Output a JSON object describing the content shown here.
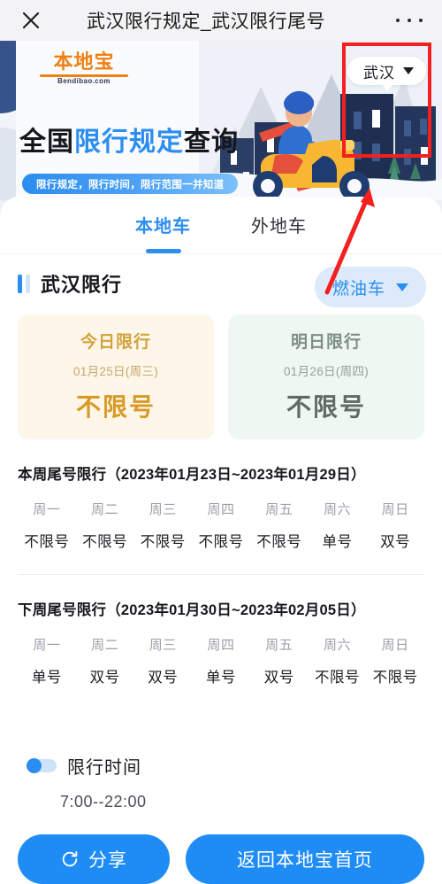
{
  "browser": {
    "title": "武汉限行规定_武汉限行尾号",
    "close_icon": "close-icon",
    "more_icon": "more-options-icon"
  },
  "banner": {
    "logo_main": "本地宝",
    "logo_sub": "Bendibao.com",
    "title_part1": "全国",
    "title_highlight": "限行规定",
    "title_part2": "查询",
    "subtitle_pill": "限行规定，限行时间，限行范围一并知道",
    "city_selector": {
      "label": "武汉",
      "caret_icon": "chevron-down-icon"
    }
  },
  "annotation": {
    "box_color": "#f41f1f",
    "arrow_color": "#f41f1f"
  },
  "tabs": [
    {
      "label": "本地车",
      "active": true
    },
    {
      "label": "外地车",
      "active": false
    }
  ],
  "section": {
    "title": "武汉限行",
    "fuel_selector": {
      "label": "燃油车",
      "caret_icon": "chevron-down-icon"
    }
  },
  "cards": [
    {
      "title": "今日限行",
      "date": "01月25日(周三)",
      "value": "不限号",
      "accent": "#d99a26",
      "bg": "#fdf6e9"
    },
    {
      "title": "明日限行",
      "date": "01月26日(周四)",
      "value": "不限号",
      "accent": "#5f6b63",
      "bg": "#eef7f1"
    }
  ],
  "weeks": [
    {
      "title": "本周尾号限行（2023年01月23日~2023年01月29日）",
      "days": [
        "周一",
        "周二",
        "周三",
        "周四",
        "周五",
        "周六",
        "周日"
      ],
      "values": [
        "不限号",
        "不限号",
        "不限号",
        "不限号",
        "不限号",
        "单号",
        "双号"
      ]
    },
    {
      "title": "下周尾号限行（2023年01月30日~2023年02月05日）",
      "days": [
        "周一",
        "周二",
        "周三",
        "周四",
        "周五",
        "周六",
        "周日"
      ],
      "values": [
        "单号",
        "双号",
        "双号",
        "单号",
        "双号",
        "不限号",
        "不限号"
      ]
    }
  ],
  "time_card": {
    "label": "限行时间",
    "value": "7:00--22:00",
    "toggle_on": true
  },
  "buttons": {
    "share": {
      "label": "分享",
      "icon": "share-refresh-icon"
    },
    "home": {
      "label": "返回本地宝首页"
    }
  },
  "colors": {
    "brand_blue": "#2b8df0",
    "button_blue": "#1f8cf5",
    "logo_orange": "#ef8014"
  }
}
